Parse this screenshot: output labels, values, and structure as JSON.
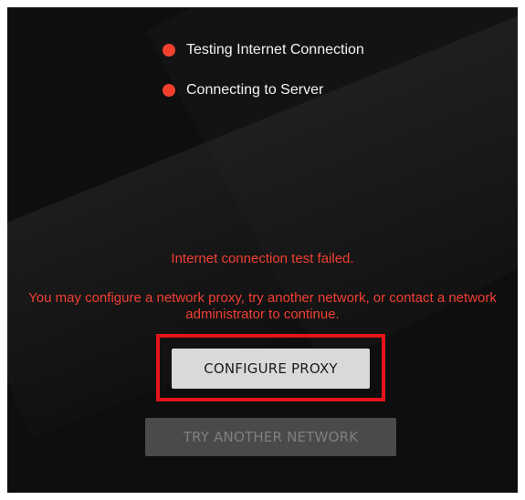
{
  "status": {
    "items": [
      {
        "label": "Testing Internet Connection",
        "state": "failed"
      },
      {
        "label": "Connecting to Server",
        "state": "failed"
      }
    ]
  },
  "error": {
    "title": "Internet connection test failed.",
    "message": "You may configure a network proxy, try another network, or contact a network administrator to continue."
  },
  "actions": {
    "configure_proxy_label": "CONFIGURE PROXY",
    "try_another_network_label": "TRY ANOTHER NETWORK"
  },
  "colors": {
    "status_dot": "#f2402f",
    "error_text": "#f13f33",
    "highlight_border": "#e5141b"
  }
}
